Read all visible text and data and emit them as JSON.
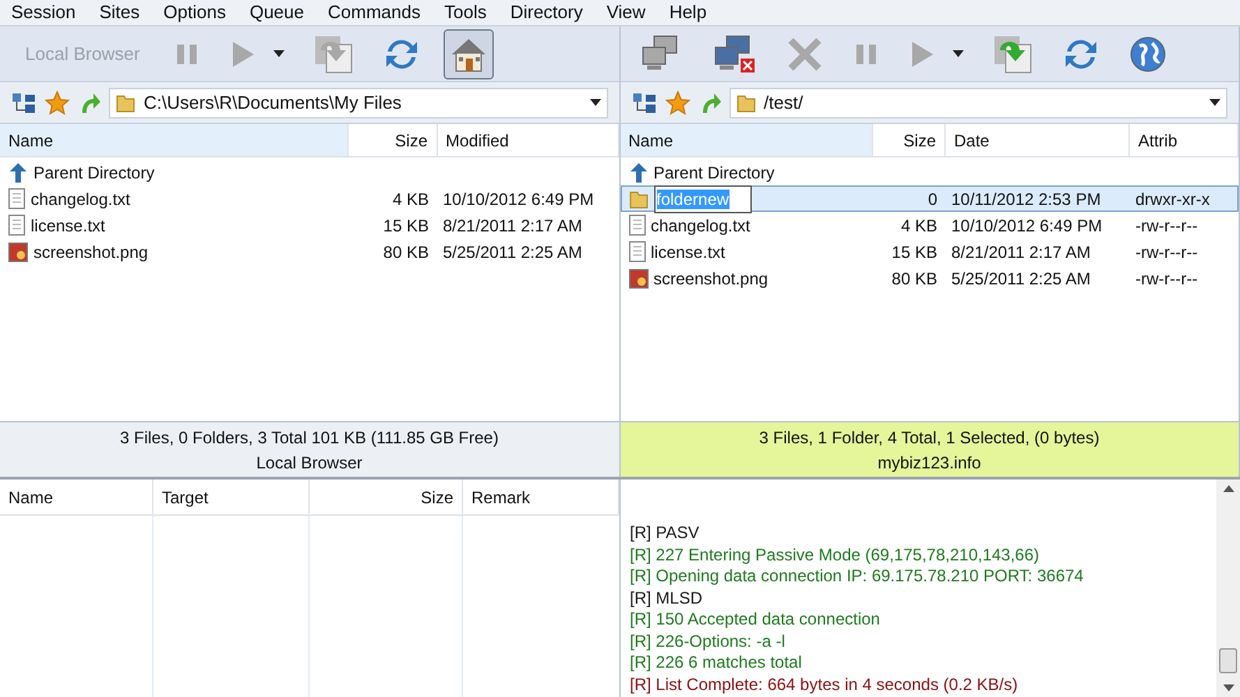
{
  "menu": [
    "Session",
    "Sites",
    "Options",
    "Queue",
    "Commands",
    "Tools",
    "Directory",
    "View",
    "Help"
  ],
  "panels": [
    {
      "active": false,
      "toolbar": [
        {
          "kind": "text",
          "label": "Local Browser",
          "disabled": true
        },
        {
          "kind": "pause",
          "disabled": true
        },
        {
          "kind": "play",
          "disabled": true
        },
        {
          "kind": "caret",
          "disabled": false
        },
        {
          "kind": "transfer",
          "disabled": true
        },
        {
          "kind": "refresh",
          "disabled": false
        },
        {
          "kind": "home",
          "disabled": false,
          "pressed": true
        }
      ],
      "path": "C:\\Users\\R\\Documents\\My Files",
      "columns": [
        "Name",
        "Size",
        "Modified"
      ],
      "rows": [
        {
          "kind": "parent",
          "cells": [
            "Parent Directory"
          ],
          "selected": false,
          "editing": false
        },
        {
          "kind": "text",
          "cells": [
            "changelog.txt",
            "4 KB",
            "10/10/2012 6:49 PM"
          ],
          "selected": false,
          "editing": false
        },
        {
          "kind": "text",
          "cells": [
            "license.txt",
            "15 KB",
            "8/21/2011 2:17 AM"
          ],
          "selected": false,
          "editing": false
        },
        {
          "kind": "image",
          "cells": [
            "screenshot.png",
            "80 KB",
            "5/25/2011 2:25 AM"
          ],
          "selected": false,
          "editing": false
        }
      ],
      "status": "3 Files, 0 Folders, 3 Total 101 KB (111.85 GB Free)",
      "title": "Local Browser"
    },
    {
      "active": true,
      "toolbar": [
        {
          "kind": "connect",
          "disabled": true
        },
        {
          "kind": "disconnect",
          "disabled": false
        },
        {
          "kind": "abort",
          "disabled": true
        },
        {
          "kind": "pause",
          "disabled": true
        },
        {
          "kind": "play",
          "disabled": true
        },
        {
          "kind": "caret",
          "disabled": false
        },
        {
          "kind": "transfer",
          "disabled": false
        },
        {
          "kind": "refresh",
          "disabled": false
        },
        {
          "kind": "globe",
          "disabled": false
        }
      ],
      "path": "/test/",
      "columns": [
        "Name",
        "Size",
        "Date",
        "Attrib"
      ],
      "rows": [
        {
          "kind": "parent",
          "cells": [
            "Parent Directory"
          ],
          "selected": false,
          "editing": false
        },
        {
          "kind": "folder",
          "cells": [
            "foldernew",
            "0",
            "10/11/2012 2:53 PM",
            "drwxr-xr-x"
          ],
          "selected": true,
          "editing": true
        },
        {
          "kind": "text",
          "cells": [
            "changelog.txt",
            "4 KB",
            "10/10/2012 6:49 PM",
            "-rw-r--r--"
          ],
          "selected": false,
          "editing": false
        },
        {
          "kind": "text",
          "cells": [
            "license.txt",
            "15 KB",
            "8/21/2011 2:17 AM",
            "-rw-r--r--"
          ],
          "selected": false,
          "editing": false
        },
        {
          "kind": "image",
          "cells": [
            "screenshot.png",
            "80 KB",
            "5/25/2011 2:25 AM",
            "-rw-r--r--"
          ],
          "selected": false,
          "editing": false
        }
      ],
      "status": "3 Files, 1 Folder, 4 Total, 1 Selected, (0 bytes)",
      "title": "mybiz123.info"
    }
  ],
  "queue": {
    "columns": [
      "Name",
      "Target",
      "Size",
      "Remark"
    ]
  },
  "log": [
    {
      "text": "[R] PASV",
      "color": "#1a1a1a"
    },
    {
      "text": "[R] 227 Entering Passive Mode (69,175,78,210,143,66)",
      "color": "#1e7a1e"
    },
    {
      "text": "[R] Opening data connection IP: 69.175.78.210 PORT: 36674",
      "color": "#1e7a1e"
    },
    {
      "text": "[R] MLSD",
      "color": "#1a1a1a"
    },
    {
      "text": "[R] 150 Accepted data connection",
      "color": "#1e7a1e"
    },
    {
      "text": "[R] 226-Options: -a -l",
      "color": "#1e7a1e"
    },
    {
      "text": "[R] 226 6 matches total",
      "color": "#1e7a1e"
    },
    {
      "text": "[R] List Complete: 664 bytes in 4 seconds (0.2 KB/s)",
      "color": "#8b1010"
    }
  ]
}
